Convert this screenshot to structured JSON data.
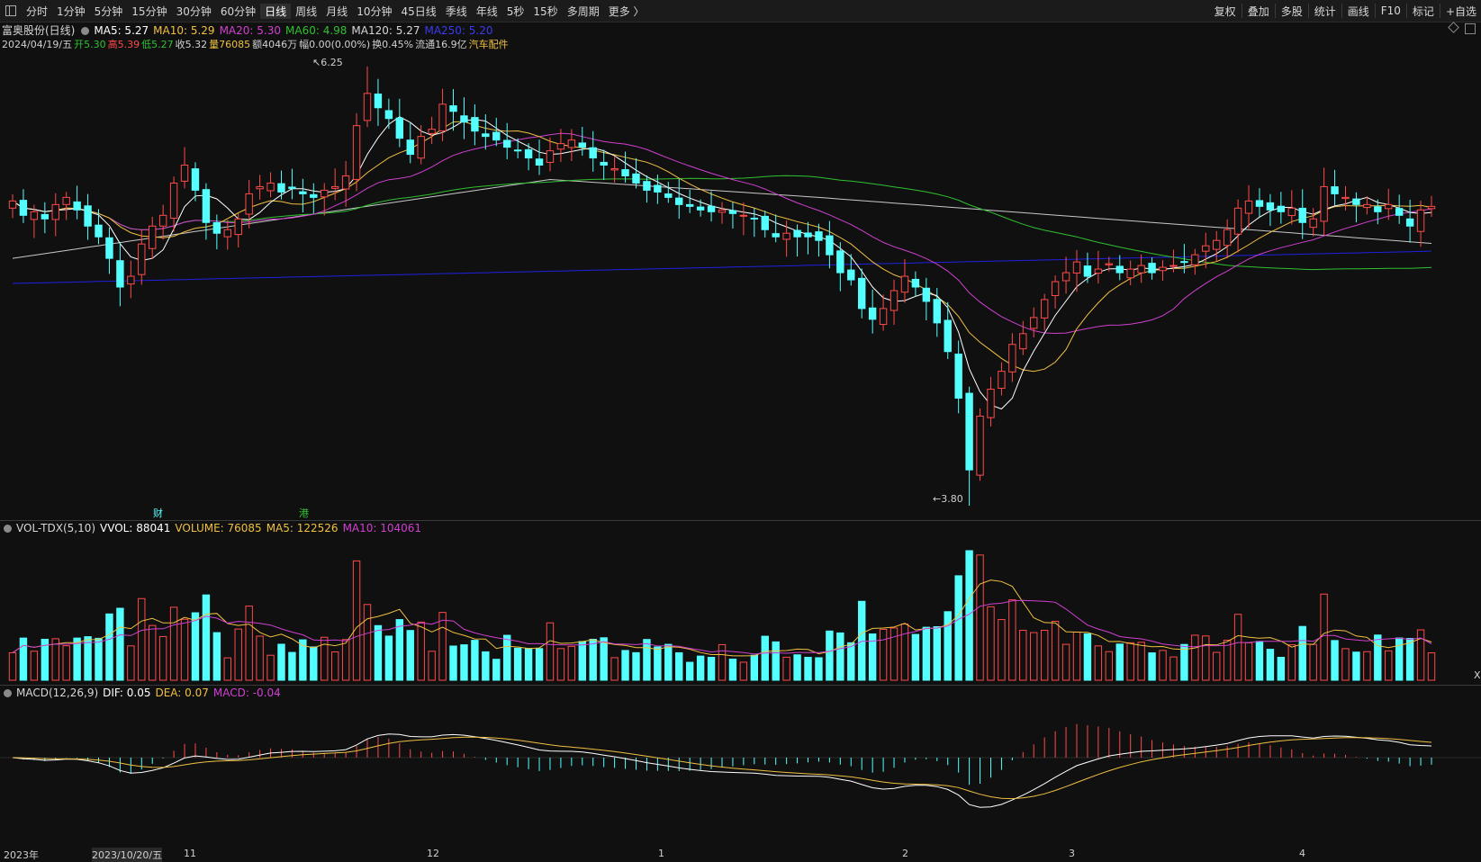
{
  "toolbar": {
    "left_items": [
      "分时",
      "1分钟",
      "5分钟",
      "15分钟",
      "30分钟",
      "60分钟",
      "日线",
      "周线",
      "月线",
      "10分钟",
      "45日线",
      "季线",
      "年线",
      "5秒",
      "15秒",
      "多周期",
      "更多 〉"
    ],
    "active": "日线",
    "right_items": [
      "复权",
      "叠加",
      "多股",
      "统计",
      "画线",
      "F10",
      "标记",
      "+自选"
    ]
  },
  "main_legend": {
    "stock_name": "富奥股份(日线)",
    "ma5": "MA5: 5.27",
    "ma10": "MA10: 5.29",
    "ma20": "MA20: 5.30",
    "ma60": "MA60: 4.98",
    "ma120": "MA120: 5.27",
    "ma250": "MA250: 5.20"
  },
  "quote_line": {
    "date": "2024/04/19/五",
    "open": "开5.30",
    "high": "高5.39",
    "low": "低5.27",
    "close": "收5.32",
    "volume": "量76085",
    "amount": "额4046万",
    "change": "幅0.00(0.00%)",
    "turnover": "换0.45%",
    "float": "流通16.9亿",
    "sector": "汽车配件"
  },
  "price_labels": {
    "high": "6.25",
    "low": "3.80"
  },
  "badges": {
    "cai": "财",
    "gang": "港"
  },
  "vol_legend": {
    "name": "VOL-TDX(5,10)",
    "vvol": "VVOL: 88041",
    "volume": "VOLUME: 76085",
    "ma5": "MA5: 122526",
    "ma10": "MA10: 104061"
  },
  "macd_legend": {
    "name": "MACD(12,26,9)",
    "dif": "DIF: 0.05",
    "dea": "DEA: 0.07",
    "macd": "MACD: -0.04"
  },
  "x_axis": [
    "2023年",
    "2023/10/20/五",
    "11",
    "12",
    "1",
    "2",
    "3",
    "4"
  ],
  "colors": {
    "up": "#ff4a4a",
    "down": "#54ffff",
    "ma5": "#ffffff",
    "ma10": "#f0c040",
    "ma20": "#d040d0",
    "ma60": "#30c030",
    "ma120": "#c8c8c8",
    "ma250": "#2020e0"
  },
  "chart_data": {
    "type": "candlestick",
    "closes": [
      5.5,
      5.42,
      5.44,
      5.4,
      5.48,
      5.52,
      5.45,
      5.36,
      5.3,
      5.18,
      5.02,
      5.08,
      5.26,
      5.36,
      5.42,
      5.6,
      5.7,
      5.56,
      5.38,
      5.32,
      5.34,
      5.4,
      5.54,
      5.58,
      5.6,
      5.55,
      5.57,
      5.54,
      5.52,
      5.56,
      5.58,
      5.64,
      5.92,
      6.1,
      6.02,
      5.96,
      5.85,
      5.76,
      5.86,
      5.9,
      6.04,
      6.0,
      5.94,
      5.89,
      5.86,
      5.84,
      5.8,
      5.78,
      5.74,
      5.7,
      5.78,
      5.82,
      5.84,
      5.8,
      5.74,
      5.7,
      5.68,
      5.64,
      5.6,
      5.56,
      5.55,
      5.52,
      5.48,
      5.47,
      5.45,
      5.44,
      5.45,
      5.43,
      5.42,
      5.4,
      5.34,
      5.3,
      5.32,
      5.3,
      5.3,
      5.28,
      5.2,
      5.1,
      5.06,
      4.9,
      4.84,
      4.9,
      5.0,
      5.08,
      5.02,
      4.94,
      4.82,
      4.66,
      4.4,
      4.0,
      4.3,
      4.45,
      4.55,
      4.7,
      4.76,
      4.85,
      4.95,
      5.05,
      5.1,
      5.16,
      5.08,
      5.12,
      5.15,
      5.1,
      5.12,
      5.14,
      5.1,
      5.13,
      5.14,
      5.16,
      5.2,
      5.25,
      5.28,
      5.34,
      5.46,
      5.5,
      5.47,
      5.45,
      5.44,
      5.46,
      5.38,
      5.4,
      5.58,
      5.54,
      5.52,
      5.48,
      5.48,
      5.44,
      5.48,
      5.42,
      5.36,
      5.45,
      5.47
    ],
    "high": 6.25,
    "low": 3.8,
    "volume": {
      "ma5": 122526,
      "ma10": 104061,
      "last": 76085
    },
    "macd": {
      "dif": 0.05,
      "dea": 0.07,
      "macd": -0.04
    }
  }
}
